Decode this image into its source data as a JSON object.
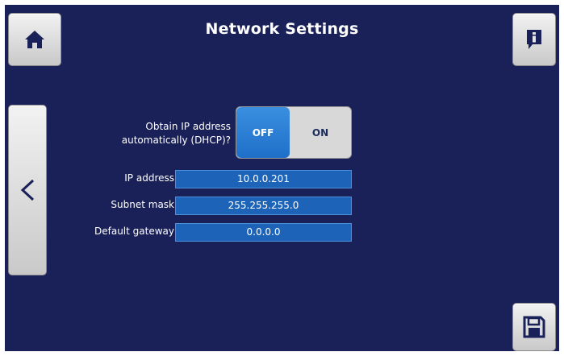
{
  "header": {
    "title": "Network Settings"
  },
  "buttons": {
    "home_icon": "home-icon",
    "info_icon": "info-icon",
    "back_label": "<",
    "save_icon": "save-icon"
  },
  "dhcp": {
    "label_line1": "Obtain IP address",
    "label_line2": "automatically (DHCP)?",
    "off_label": "OFF",
    "on_label": "ON",
    "selected": "OFF"
  },
  "fields": [
    {
      "label": "IP address",
      "value": "10.0.0.201"
    },
    {
      "label": "Subnet mask",
      "value": "255.255.255.0"
    },
    {
      "label": "Default gateway",
      "value": "0.0.0.0"
    }
  ],
  "colors": {
    "background": "#1a2159",
    "field": "#1d64b8",
    "toggle_active": "#2a7fd8"
  }
}
